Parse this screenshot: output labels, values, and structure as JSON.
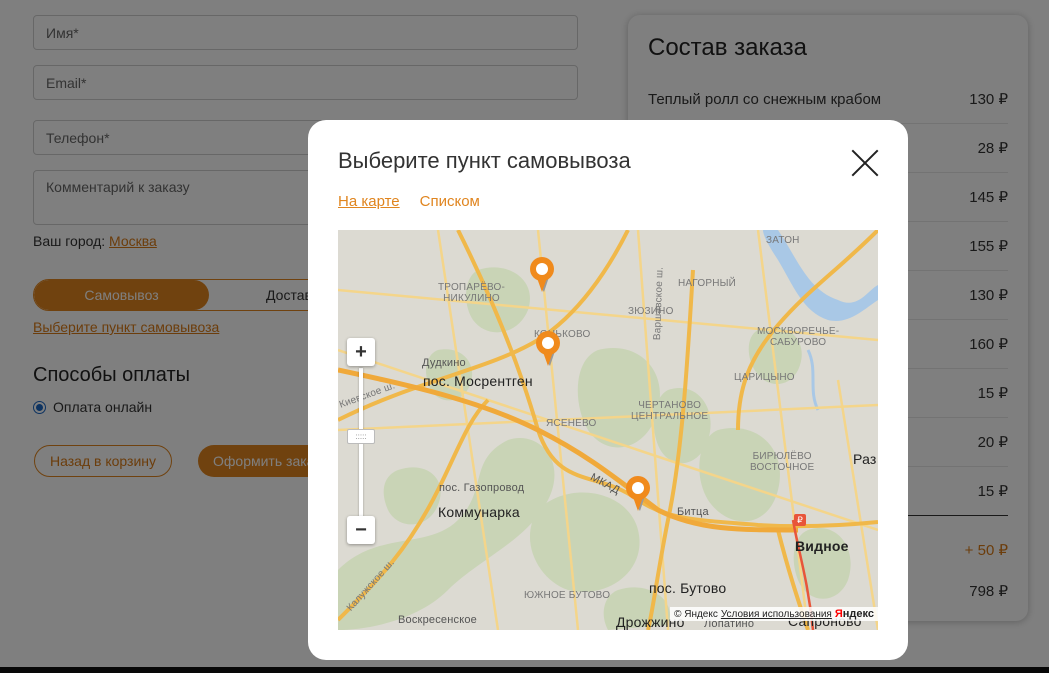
{
  "form": {
    "name_placeholder": "Имя*",
    "email_placeholder": "Email*",
    "phone_placeholder": "Телефон*",
    "comment_placeholder": "Комментарий к заказу",
    "city_label": "Ваш город:",
    "city_value": "Москва",
    "delivery_options": [
      "Самовывоз",
      "Достав"
    ],
    "pickup_link": "Выберите пункт самовывоза",
    "payment_title": "Способы оплаты",
    "payment_option": "Оплата онлайн",
    "back_button": "Назад в корзину",
    "submit_button": "Оформить зака"
  },
  "order": {
    "title": "Состав заказа",
    "first_item": "Теплый ролл со снежным крабом",
    "prices": [
      "130 ₽",
      "28 ₽",
      "145 ₽",
      "155 ₽",
      "130 ₽",
      "160 ₽",
      "15 ₽",
      "20 ₽",
      "15 ₽"
    ],
    "discount": "+ 50 ₽",
    "total": "798 ₽"
  },
  "modal": {
    "title": "Выберите пункт самовывоза",
    "tabs": [
      "На карте",
      "Списком"
    ],
    "active_tab": "На карте"
  },
  "map": {
    "labels": {
      "troparevo": "ТРОПАРЁВО-\nНИКУЛИНО",
      "nagorny": "НАГОРНЫЙ",
      "zyuzino": "ЗЮЗИНО",
      "konkovo": "КОНЬКОВО",
      "dudkino": "Дудкино",
      "mosrentgen": "пос. Мосрентген",
      "kievskoe": "Киевское ш.",
      "yasenevo": "ЯСЕНЕВО",
      "chertanovo": "ЧЕРТАНОВО\nЦЕНТРАЛЬНОЕ",
      "tsaritsyno": "ЦАРИЦЫНО",
      "moskvorechye": "МОСКВОРЕЧЬЕ-\nСАБУРОВО",
      "zaton": "ЗАТОН",
      "biryulyovo": "БИРЮЛЁВО\nВОСТОЧНОЕ",
      "varshavskoe": "Варшавское ш.",
      "mkad": "МКАД",
      "gazoprovod": "пос. Газопровод",
      "kommunarka": "Коммунарка",
      "bitsa": "Битца",
      "vidnoe": "Видное",
      "butovo": "пос. Бутово",
      "yuzhnoe_butovo": "ЮЖНОЕ БУТОВО",
      "kaluzhskoe": "Калужское ш.",
      "voskresenskoe": "Воскресенское",
      "drozhzhino": "Дрожжино",
      "lopatino": "Лопатино",
      "sapronovo": "Сапроново",
      "ra": "Раз"
    },
    "copyright": "© Яндекс",
    "terms": "Условия использования",
    "logo_y": "Я",
    "logo_rest": "ндекс",
    "zoom_in": "+",
    "zoom_out": "−",
    "zoom_handle": ":::::"
  },
  "colors": {
    "accent": "#e0851f",
    "road": "#f2c25a",
    "forest": "#c8d3b4"
  }
}
